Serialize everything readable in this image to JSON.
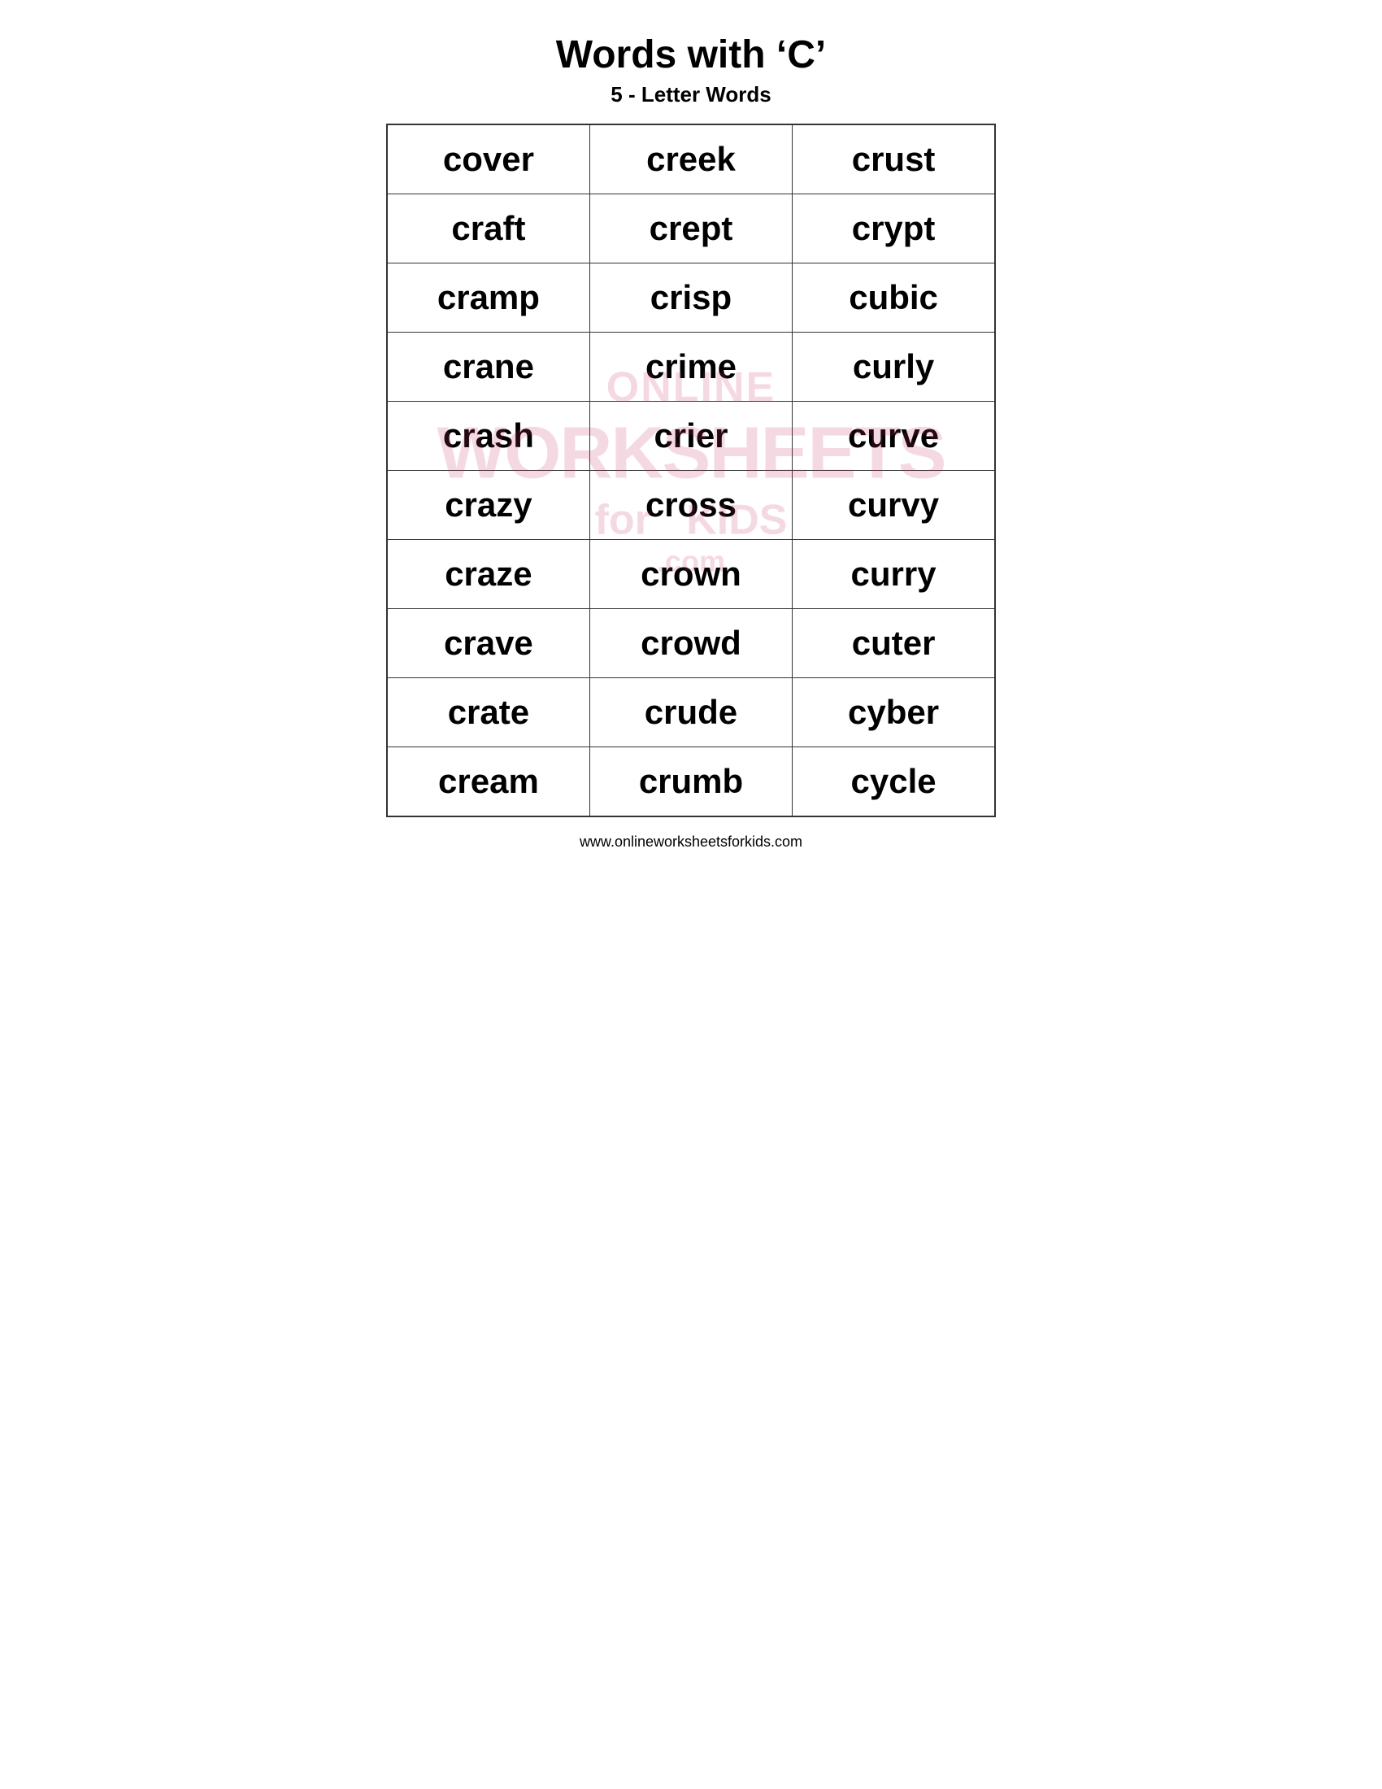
{
  "header": {
    "title": "Words with ‘C’",
    "subtitle": "5 - Letter Words"
  },
  "rows": [
    [
      "cover",
      "creek",
      "crust"
    ],
    [
      "craft",
      "crept",
      "crypt"
    ],
    [
      "cramp",
      "crisp",
      "cubic"
    ],
    [
      "crane",
      "crime",
      "curly"
    ],
    [
      "crash",
      "crier",
      "curve"
    ],
    [
      "crazy",
      "cross",
      "curvy"
    ],
    [
      "craze",
      "crown",
      "curry"
    ],
    [
      "crave",
      "crowd",
      "cuter"
    ],
    [
      "crate",
      "crude",
      "cyber"
    ],
    [
      "cream",
      "crumb",
      "cycle"
    ]
  ],
  "watermark": {
    "top": "ONLINE",
    "middle": "WORKSHEETS",
    "for": "for",
    "kids": "KIDS",
    "com": ".com"
  },
  "footer": {
    "url": "www.onlineworksheetsforkids.com"
  }
}
